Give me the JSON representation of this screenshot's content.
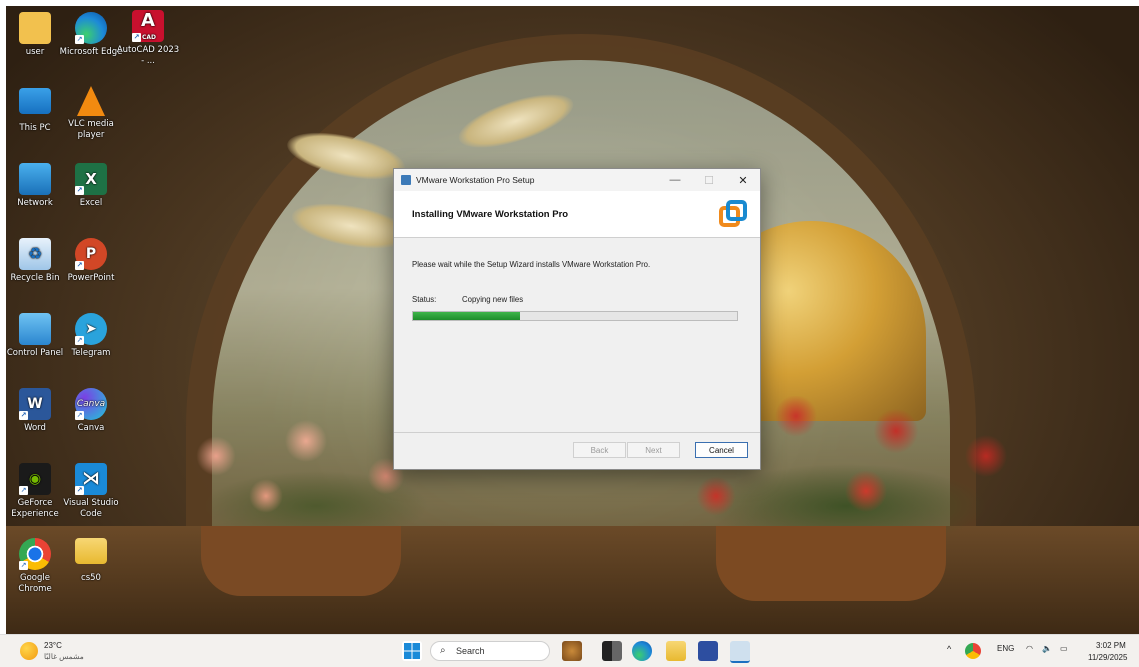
{
  "desktop": {
    "icons": [
      {
        "label": "user"
      },
      {
        "label": "Microsoft Edge"
      },
      {
        "label": "AutoCAD 2023 - ...",
        "badge": "CAD"
      },
      {
        "label": "This PC"
      },
      {
        "label": "VLC media player"
      },
      {
        "label": "Network"
      },
      {
        "label": "Excel"
      },
      {
        "label": "Recycle Bin"
      },
      {
        "label": "PowerPoint"
      },
      {
        "label": "Control Panel"
      },
      {
        "label": "Telegram"
      },
      {
        "label": "Word"
      },
      {
        "label": "Canva"
      },
      {
        "label": "GeForce Experience"
      },
      {
        "label": "Visual Studio Code"
      },
      {
        "label": "Google Chrome"
      },
      {
        "label": "cs50"
      }
    ]
  },
  "dialog": {
    "title": "VMware Workstation Pro Setup",
    "heading": "Installing VMware Workstation Pro",
    "message": "Please wait while the Setup Wizard installs VMware Workstation Pro.",
    "status_label": "Status:",
    "status_value": "Copying new files",
    "progress": 0.33,
    "buttons": {
      "back": "Back",
      "next": "Next",
      "cancel": "Cancel"
    },
    "controls": {
      "minimize": "—",
      "maximize": "☐",
      "close": "✕"
    }
  },
  "taskbar": {
    "weather": {
      "temp": "23°C",
      "desc": "مشمس غالبًا"
    },
    "search_placeholder": "Search",
    "tray": {
      "language": "ENG",
      "time": "3:02 PM",
      "date": "11/29/2025",
      "chevron": "^"
    }
  },
  "colors": {
    "progress": "#2aa038",
    "accent": "#3a6fb0",
    "taskbar": "#f3f1ee"
  }
}
